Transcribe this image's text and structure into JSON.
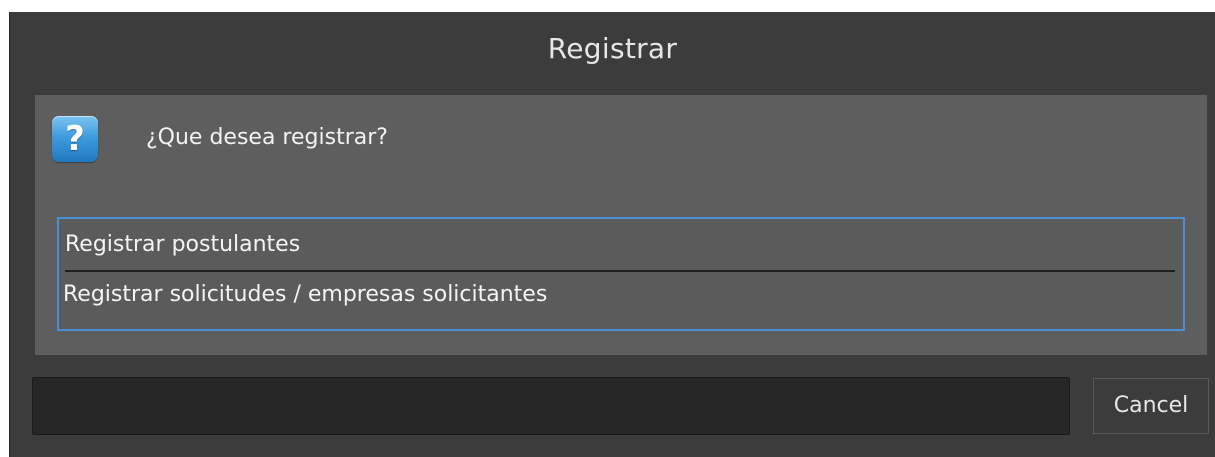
{
  "dialog": {
    "title": "Registrar",
    "prompt": "¿Que desea registrar?",
    "icon": "question-icon",
    "icon_glyph": "?",
    "options": [
      {
        "label": "Registrar postulantes"
      },
      {
        "label": "Registrar solicitudes / empresas solicitantes"
      }
    ],
    "cancel_label": "Cancel"
  },
  "colors": {
    "background": "#3c3c3c",
    "panel": "#5e5e5e",
    "list_border": "#4b8fd6",
    "icon_blue": "#3e9ddd",
    "text": "#f2f2f2"
  }
}
